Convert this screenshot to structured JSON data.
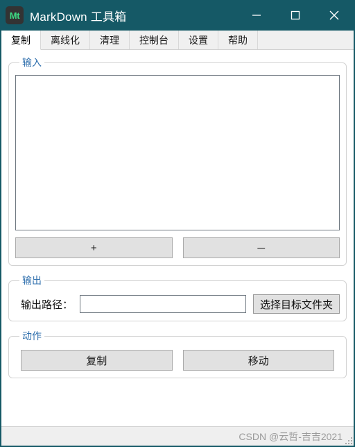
{
  "window": {
    "title": "MarkDown 工具箱",
    "icon_label": "Mt",
    "icon_name": "markdown-app-icon",
    "titlebar_color": "#155966",
    "controls": {
      "minimize": "minimize-icon",
      "maximize": "maximize-icon",
      "close": "close-icon"
    }
  },
  "tabs": [
    {
      "label": "复制",
      "active": true
    },
    {
      "label": "离线化",
      "active": false
    },
    {
      "label": "清理",
      "active": false
    },
    {
      "label": "控制台",
      "active": false
    },
    {
      "label": "设置",
      "active": false
    },
    {
      "label": "帮助",
      "active": false
    }
  ],
  "input_group": {
    "legend": "输入",
    "textarea_value": "",
    "textarea_placeholder": "",
    "add_button": "+",
    "remove_button": "－"
  },
  "output_group": {
    "legend": "输出",
    "path_label": "输出路径：",
    "path_value": "",
    "path_placeholder": "",
    "pick_button": "选择目标文件夹"
  },
  "action_group": {
    "legend": "动作",
    "copy_button": "复制",
    "move_button": "移动"
  },
  "statusbar": {
    "watermark": "CSDN @云哲-吉吉2021"
  },
  "colors": {
    "accent": "#155966",
    "legend": "#2f6fad",
    "button_face": "#e1e1e1",
    "icon_green": "#3ddc84"
  }
}
